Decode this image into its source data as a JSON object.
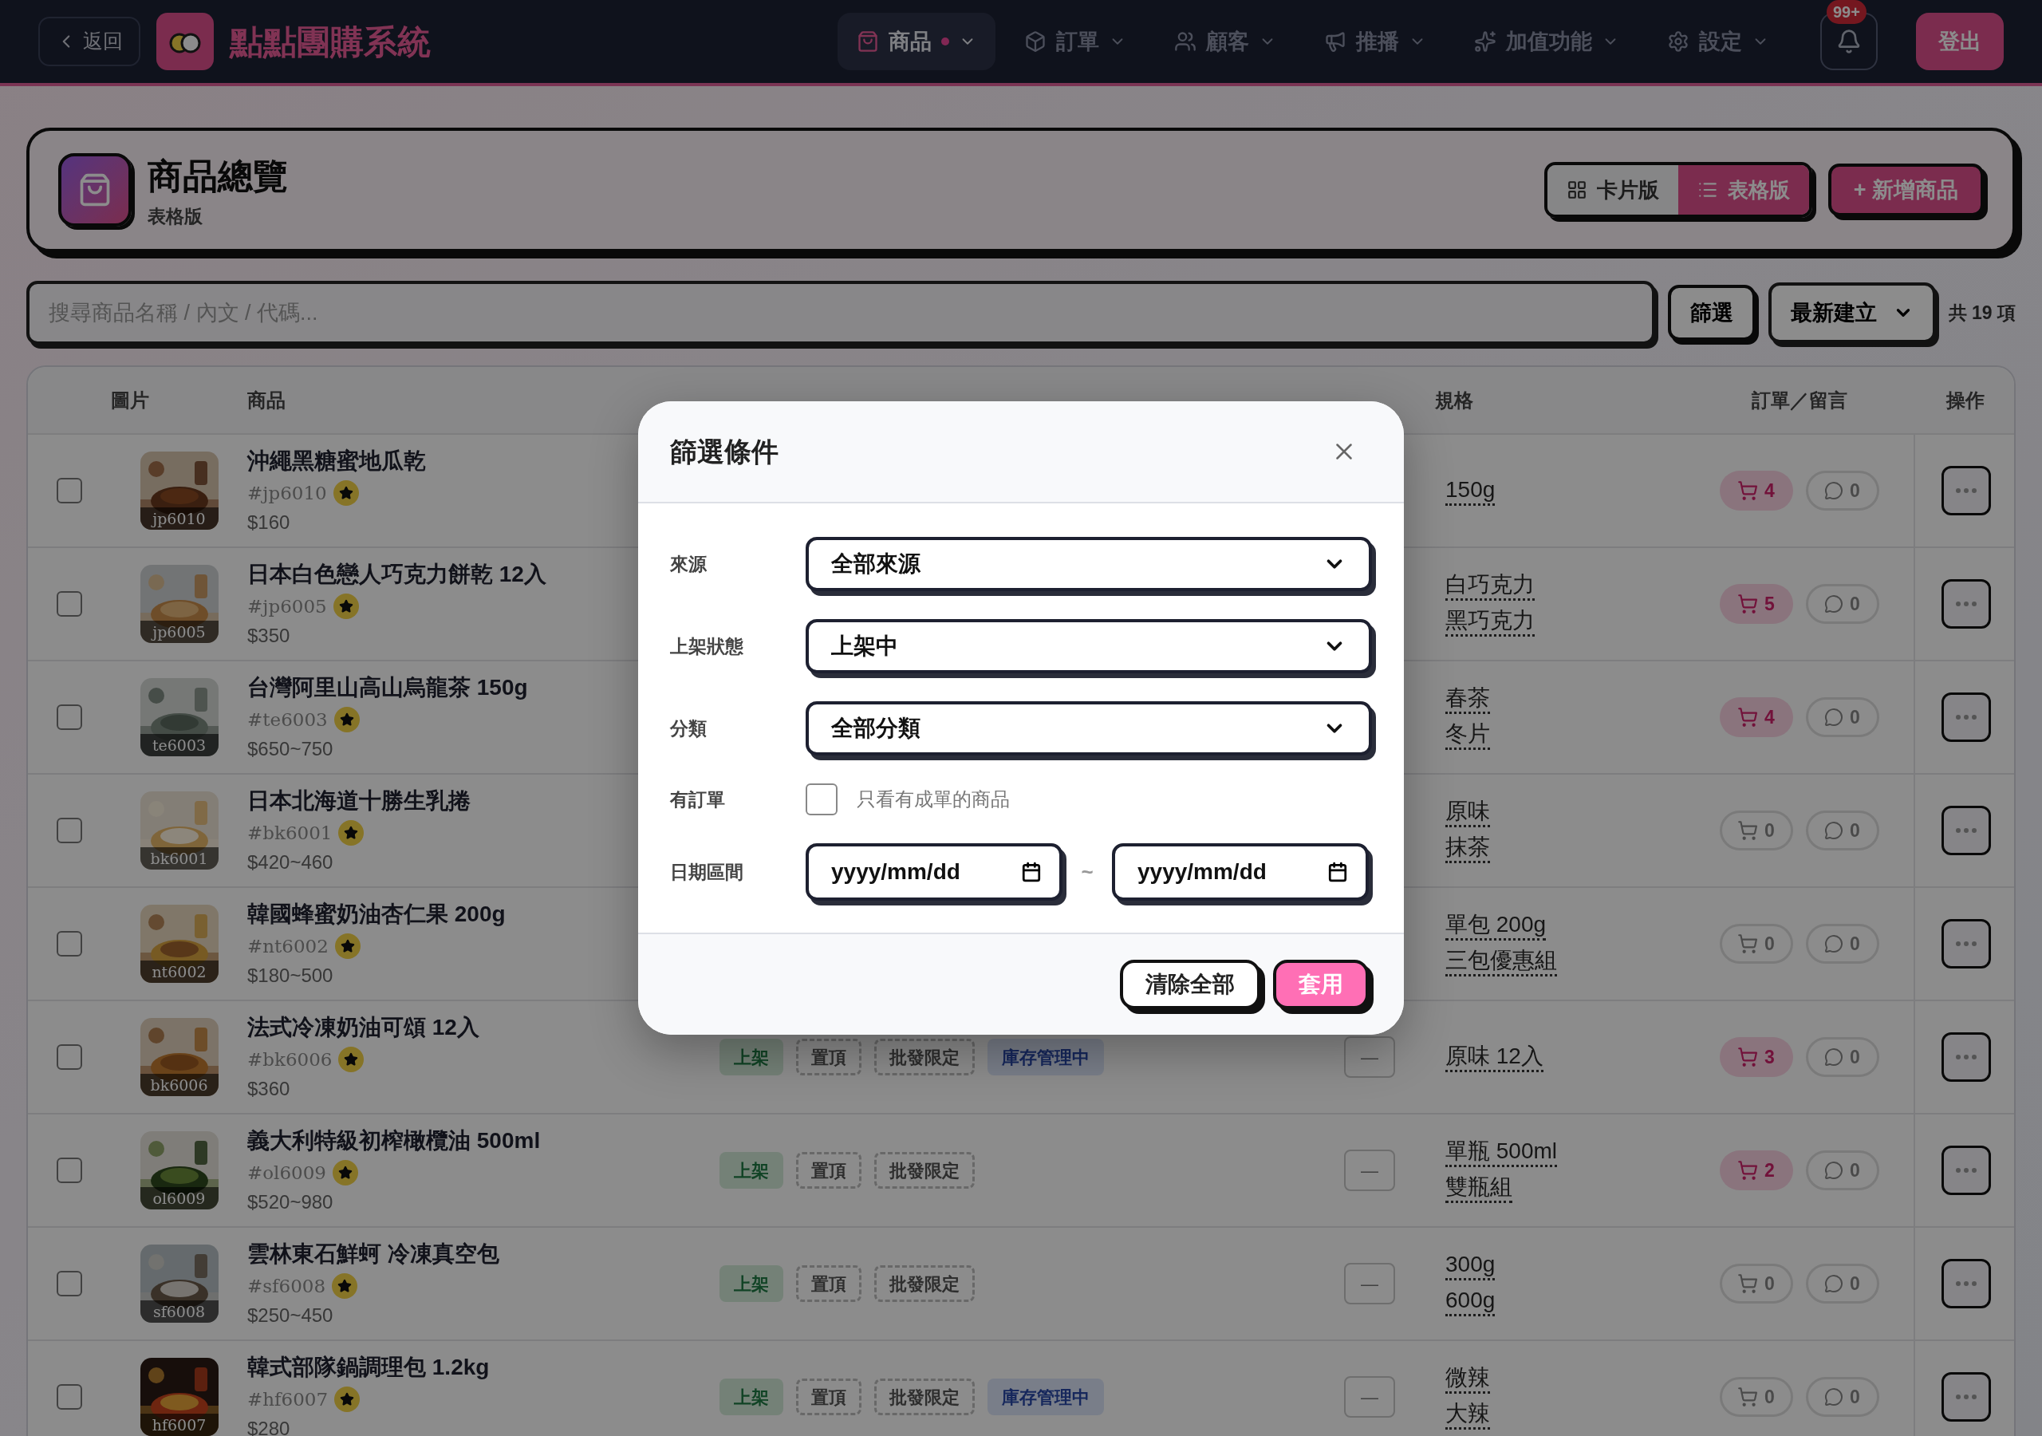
{
  "nav": {
    "back": "返回",
    "brand": "點點團購系統",
    "items": [
      {
        "label": "商品",
        "selected": true
      },
      {
        "label": "訂單",
        "selected": false
      },
      {
        "label": "顧客",
        "selected": false
      },
      {
        "label": "推播",
        "selected": false
      },
      {
        "label": "加值功能",
        "selected": false
      },
      {
        "label": "設定",
        "selected": false
      }
    ],
    "notifications": "99+",
    "logout": "登出"
  },
  "header": {
    "title": "商品總覽",
    "subtitle": "表格版",
    "views": [
      {
        "label": "卡片版",
        "selected": false
      },
      {
        "label": "表格版",
        "selected": true
      }
    ],
    "add": "+ 新增商品"
  },
  "toolbar": {
    "search_placeholder": "搜尋商品名稱 / 內文 / 代碼...",
    "filter": "篩選",
    "sort": "最新建立",
    "count": "共 19 項"
  },
  "table": {
    "columns": [
      "圖片",
      "商品",
      "規格",
      "訂單／留言",
      "操作"
    ],
    "rows": [
      {
        "selected": false,
        "image_label": "jp6010",
        "name": "沖繩黑糖蜜地瓜乾",
        "code": "#jp6010",
        "featured": true,
        "price": "$160",
        "specs": [
          "150g"
        ],
        "orders": "4",
        "has_orders": true,
        "comments": "0"
      },
      {
        "selected": false,
        "image_label": "jp6005",
        "name": "日本白色戀人巧克力餅乾 12入",
        "code": "#jp6005",
        "featured": true,
        "price": "$350",
        "specs": [
          "白巧克力",
          "黑巧克力"
        ],
        "orders": "5",
        "has_orders": true,
        "comments": "0"
      },
      {
        "selected": false,
        "image_label": "te6003",
        "name": "台灣阿里山高山烏龍茶 150g",
        "code": "#te6003",
        "featured": true,
        "price": "$650~750",
        "specs": [
          "春茶",
          "冬片"
        ],
        "orders": "4",
        "has_orders": true,
        "comments": "0"
      },
      {
        "selected": false,
        "image_label": "bk6001",
        "name": "日本北海道十勝生乳捲",
        "code": "#bk6001",
        "featured": true,
        "price": "$420~460",
        "specs": [
          "原味",
          "抹茶"
        ],
        "orders": "0",
        "has_orders": false,
        "comments": "0"
      },
      {
        "selected": false,
        "image_label": "nt6002",
        "name": "韓國蜂蜜奶油杏仁果 200g",
        "code": "#nt6002",
        "featured": true,
        "price": "$180~500",
        "specs": [
          "單包 200g",
          "三包優惠組"
        ],
        "orders": "0",
        "has_orders": false,
        "comments": "0"
      },
      {
        "selected": false,
        "image_label": "bk6006",
        "name": "法式冷凍奶油可頌 12入",
        "code": "#bk6006",
        "featured": true,
        "price": "$360",
        "tags": [
          {
            "kind": "listed",
            "label": "上架"
          },
          {
            "kind": "dashed",
            "label": "置頂"
          },
          {
            "kind": "dashed",
            "label": "批發限定"
          },
          {
            "kind": "stock",
            "label": "庫存管理中"
          }
        ],
        "deadline": "—",
        "specs": [
          "原味 12入"
        ],
        "orders": "3",
        "has_orders": true,
        "comments": "0"
      },
      {
        "selected": false,
        "image_label": "ol6009",
        "name": "義大利特級初榨橄欖油 500ml",
        "code": "#ol6009",
        "featured": true,
        "price": "$520~980",
        "tags": [
          {
            "kind": "listed",
            "label": "上架"
          },
          {
            "kind": "dashed",
            "label": "置頂"
          },
          {
            "kind": "dashed",
            "label": "批發限定"
          }
        ],
        "deadline": "—",
        "specs": [
          "單瓶 500ml",
          "雙瓶組"
        ],
        "orders": "2",
        "has_orders": true,
        "comments": "0"
      },
      {
        "selected": false,
        "image_label": "sf6008",
        "name": "雲林東石鮮蚵 冷凍真空包",
        "code": "#sf6008",
        "featured": true,
        "price": "$250~450",
        "tags": [
          {
            "kind": "listed",
            "label": "上架"
          },
          {
            "kind": "dashed",
            "label": "置頂"
          },
          {
            "kind": "dashed",
            "label": "批發限定"
          }
        ],
        "deadline": "—",
        "specs": [
          "300g",
          "600g"
        ],
        "orders": "0",
        "has_orders": false,
        "comments": "0"
      },
      {
        "selected": false,
        "image_label": "hf6007",
        "name": "韓式部隊鍋調理包 1.2kg",
        "code": "#hf6007",
        "featured": true,
        "price": "$280",
        "tags": [
          {
            "kind": "listed",
            "label": "上架"
          },
          {
            "kind": "dashed",
            "label": "置頂"
          },
          {
            "kind": "dashed",
            "label": "批發限定"
          },
          {
            "kind": "stock",
            "label": "庫存管理中"
          }
        ],
        "deadline": "—",
        "specs": [
          "微辣",
          "大辣"
        ],
        "orders": "0",
        "has_orders": false,
        "comments": "0"
      }
    ]
  },
  "modal": {
    "title": "篩選條件",
    "fields": [
      {
        "kind": "select",
        "label": "來源",
        "value": "全部來源"
      },
      {
        "kind": "select",
        "label": "上架狀態",
        "value": "上架中"
      },
      {
        "kind": "select",
        "label": "分類",
        "value": "全部分類"
      },
      {
        "kind": "checkbox",
        "label": "有訂單",
        "text": "只看有成單的商品",
        "checked": false
      },
      {
        "kind": "daterange",
        "label": "日期區間",
        "from_placeholder": "yyyy/mm/dd",
        "separator": "~",
        "to_placeholder": "yyyy/mm/dd"
      }
    ],
    "clear": "清除全部",
    "apply": "套用"
  }
}
